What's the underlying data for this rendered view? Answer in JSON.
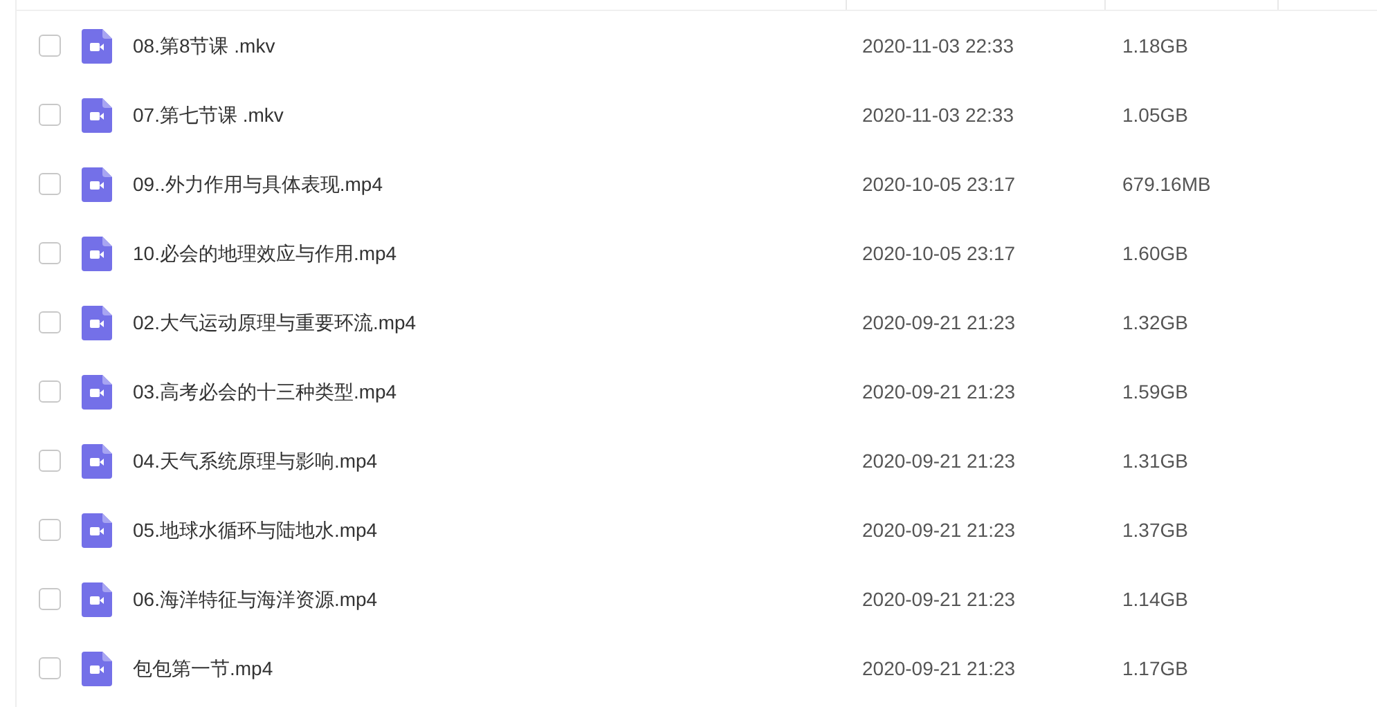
{
  "files": [
    {
      "name": "08.第8节课 .mkv",
      "modified": "2020-11-03 22:33",
      "size": "1.18GB",
      "checked": false
    },
    {
      "name": "07.第七节课 .mkv",
      "modified": "2020-11-03 22:33",
      "size": "1.05GB",
      "checked": false
    },
    {
      "name": "09..外力作用与具体表现.mp4",
      "modified": "2020-10-05 23:17",
      "size": "679.16MB",
      "checked": false
    },
    {
      "name": "10.必会的地理效应与作用.mp4",
      "modified": "2020-10-05 23:17",
      "size": "1.60GB",
      "checked": false
    },
    {
      "name": "02.大气运动原理与重要环流.mp4",
      "modified": "2020-09-21 21:23",
      "size": "1.32GB",
      "checked": false
    },
    {
      "name": "03.高考必会的十三种类型.mp4",
      "modified": "2020-09-21 21:23",
      "size": "1.59GB",
      "checked": false
    },
    {
      "name": "04.天气系统原理与影响.mp4",
      "modified": "2020-09-21 21:23",
      "size": "1.31GB",
      "checked": false
    },
    {
      "name": "05.地球水循环与陆地水.mp4",
      "modified": "2020-09-21 21:23",
      "size": "1.37GB",
      "checked": false
    },
    {
      "name": "06.海洋特征与海洋资源.mp4",
      "modified": "2020-09-21 21:23",
      "size": "1.14GB",
      "checked": false
    },
    {
      "name": "包包第一节.mp4",
      "modified": "2020-09-21 21:23",
      "size": "1.17GB",
      "checked": false
    }
  ]
}
